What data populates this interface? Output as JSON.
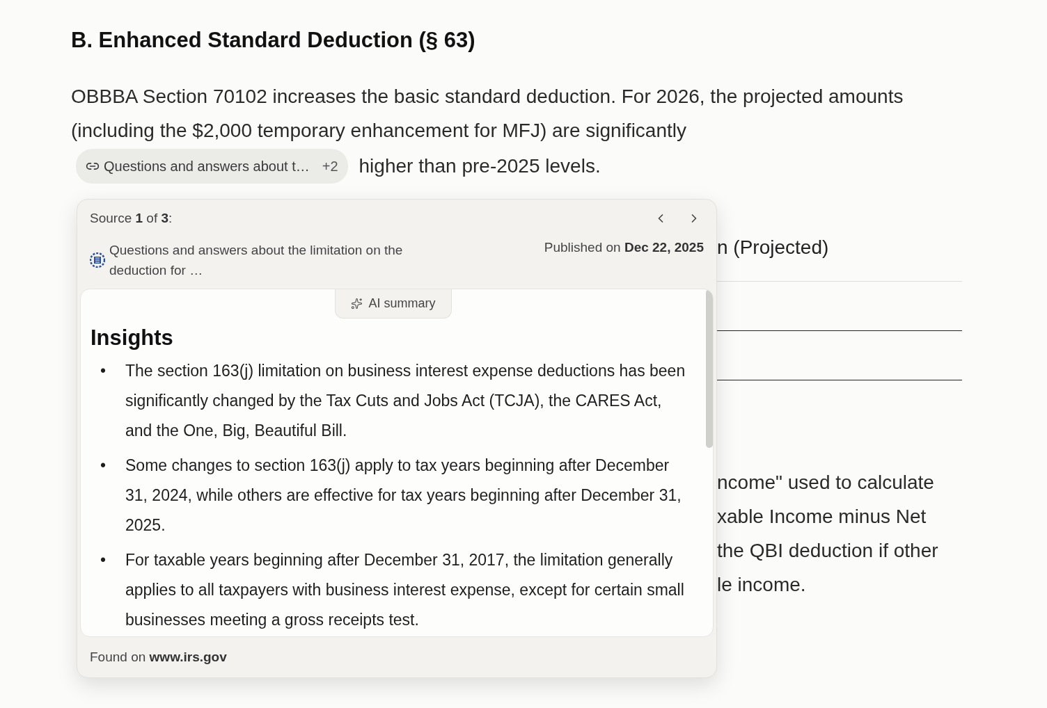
{
  "heading": "B. Enhanced Standard Deduction (§ 63)",
  "paragraph": {
    "text": "OBBBA Section 70102 increases the basic standard deduction. For 2026, the projected amounts (including the $2,000 temporary enhancement for MFJ) are significantly",
    "citation": {
      "label": "Questions and answers about t…",
      "count": "+2"
    },
    "after": "higher than pre-2025 levels."
  },
  "background": {
    "subheading": "n (Projected)",
    "text_lines": [
      "ncome\" used to calculate",
      "xable Income minus Net",
      "the QBI deduction if other",
      "le income."
    ]
  },
  "source_popup": {
    "position": "Source **1** of **3**:",
    "source_title": "Questions and answers about the limitation on the deduction for …",
    "published": "Published on **Dec 22, 2025**",
    "tab": "AI summary",
    "summary_heading": "Insights",
    "bullets": [
      {
        "marker": "•",
        "text": "The section 163(j) limitation on business interest expense deductions has been significantly changed by the Tax Cuts and Jobs Act (TCJA), the CARES Act, and the One, Big, Beautiful Bill."
      },
      {
        "marker": "•",
        "text": "Some changes to section 163(j) apply to tax years beginning after December 31, 2024, while others are effective for tax years beginning after December 31, 2025."
      },
      {
        "marker": "•",
        "text": "For taxable years beginning after December 31, 2017, the limitation generally applies to all taxpayers with business interest expense, except for certain small businesses meeting a gross receipts test."
      }
    ],
    "footer": "Found on **www.irs.gov**"
  }
}
